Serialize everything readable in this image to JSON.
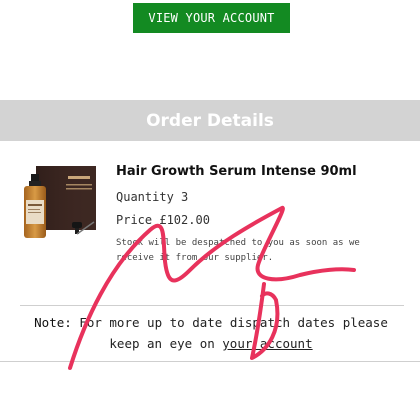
{
  "header": {
    "account_button_label": "VIEW YOUR ACCOUNT"
  },
  "order": {
    "section_title": "Order Details",
    "item": {
      "name": "Hair Growth Serum Intense 90ml",
      "quantity_text": "Quantity 3",
      "price_text": "Price £102.00",
      "stock_notice": "Stock will be despatched to you as soon as we receive it from our supplier."
    }
  },
  "footer_note": {
    "label": "Note:",
    "text_before_link": " For more up to date dispatch dates please keep an eye on ",
    "link_text": "your account"
  },
  "colors": {
    "accent_green": "#138a22",
    "section_bar": "#d3d3d3",
    "scribble": "#e8325c"
  },
  "icons": [
    "product-bottle-icon",
    "product-box-icon",
    "dropper-icon"
  ]
}
